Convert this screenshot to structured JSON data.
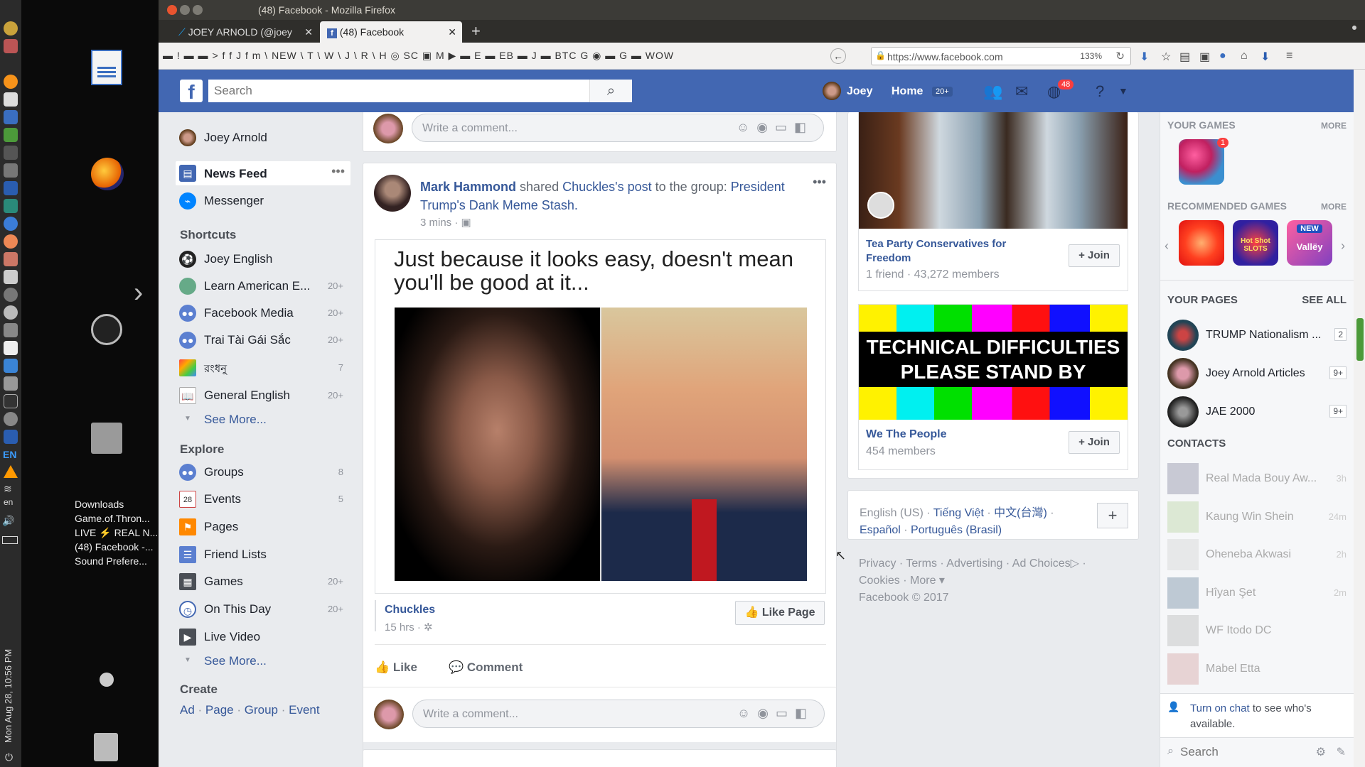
{
  "window": {
    "title": "(48) Facebook - Mozilla Firefox",
    "tabs": [
      {
        "label": "JOEY ARNOLD (@joey"
      },
      {
        "label": "(48) Facebook"
      }
    ],
    "url": "https://www.facebook.com",
    "zoom": "133%"
  },
  "bookmarks": "▬ ! ▬ ▬ > f f J f m \\ NEW \\ T \\ W \\ J \\ R \\ H ◎ SC ▣ M ▶ ▬ E ▬ EB ▬ J ▬ BTC G ◉ ▬ G ▬ WOW",
  "desktop": {
    "list": [
      "Downloads",
      "Game.of.Thron...",
      "LIVE ⚡ REAL N...",
      "(48) Facebook -...",
      "Sound Prefere..."
    ],
    "lang": "EN",
    "lang2": "en",
    "clock": "Mon Aug 28, 10:56 PM"
  },
  "header": {
    "search_placeholder": "Search",
    "user": "Joey",
    "home": "Home",
    "home_count": "20+",
    "notif_count": "48"
  },
  "left_nav": {
    "profile": "Joey Arnold",
    "news_feed": "News Feed",
    "messenger": "Messenger",
    "shortcuts_heading": "Shortcuts",
    "shortcuts": [
      {
        "label": "Joey English",
        "count": ""
      },
      {
        "label": "Learn American E...",
        "count": "20+"
      },
      {
        "label": "Facebook Media",
        "count": "20+"
      },
      {
        "label": "Trai Tài Gái Sắc",
        "count": "20+"
      },
      {
        "label": "রংধনু",
        "count": "7"
      },
      {
        "label": "General English",
        "count": "20+"
      }
    ],
    "see_more": "See More...",
    "explore_heading": "Explore",
    "explore": [
      {
        "label": "Groups",
        "count": "8"
      },
      {
        "label": "Events",
        "count": "5"
      },
      {
        "label": "Pages",
        "count": ""
      },
      {
        "label": "Friend Lists",
        "count": ""
      },
      {
        "label": "Games",
        "count": "20+"
      },
      {
        "label": "On This Day",
        "count": "20+"
      },
      {
        "label": "Live Video",
        "count": ""
      }
    ],
    "see_more_2": "See More...",
    "create_heading": "Create",
    "create_links": [
      "Ad",
      "Page",
      "Group",
      "Event"
    ],
    "events_day": "28"
  },
  "feed": {
    "comment_placeholder": "Write a comment...",
    "post": {
      "author": "Mark Hammond",
      "shared": "shared",
      "source": "Chuckles",
      "source_suffix": "'s",
      "post_word": "post",
      "to_group": "to the group:",
      "group": "President Trump's Dank Meme Stash.",
      "time": "3 mins · ",
      "meme_text": "Just because it looks easy, doesn't mean you'll be good at it...",
      "page_name": "Chuckles",
      "page_time": "15 hrs · ",
      "like_page": "Like Page",
      "like": "Like",
      "comment": "Comment"
    }
  },
  "right_col": {
    "group1_name": "Tea Party Conservatives for Freedom",
    "group1_meta": "1 friend · 43,272 members",
    "group2_banner_line1": "TECHNICAL DIFFICULTIES",
    "group2_banner_line2": "PLEASE STAND BY",
    "group2_name": "We The People",
    "group2_meta": "454 members",
    "join": "+ Join",
    "languages_line1": [
      "English (US)",
      "Tiếng Việt",
      "中文(台灣)"
    ],
    "languages_line2": [
      "Español",
      "Português (Brasil)"
    ],
    "footer_line1": [
      "Privacy",
      "Terms",
      "Advertising",
      "Ad Choices"
    ],
    "footer_line2": [
      "Cookies",
      "More ▾"
    ],
    "copyright": "Facebook © 2017"
  },
  "sidebar": {
    "your_games": "YOUR GAMES",
    "more": "MORE",
    "games_badge": "1",
    "recommended_games": "RECOMMENDED GAMES",
    "rec_game_label_1": "NEW",
    "rec_game_label_2": "Hot Shot SLOTS",
    "rec_game_label_3": "Vallëy",
    "your_pages": "YOUR PAGES",
    "see_all": "SEE ALL",
    "pages": [
      {
        "label": "TRUMP Nationalism ...",
        "count": "2"
      },
      {
        "label": "Joey Arnold Articles",
        "count": "9+"
      },
      {
        "label": "JAE 2000",
        "count": "9+"
      }
    ],
    "contacts_heading": "CONTACTS",
    "contacts": [
      {
        "name": "Real Mada Bouy Aw...",
        "time": "3h"
      },
      {
        "name": "Kaung Win Shein",
        "time": "24m"
      },
      {
        "name": "Oheneba Akwasi",
        "time": "2h"
      },
      {
        "name": "Hîyan Şet",
        "time": "2m"
      },
      {
        "name": "WF Itodo DC",
        "time": ""
      },
      {
        "name": "Mabel Etta",
        "time": ""
      }
    ],
    "chat_link": "Turn on chat",
    "chat_suffix": " to see who's available.",
    "search_placeholder": "Search"
  },
  "colors": {
    "fb_blue": "#4267b2",
    "link": "#365899",
    "notif_red": "#fa3e3e"
  }
}
